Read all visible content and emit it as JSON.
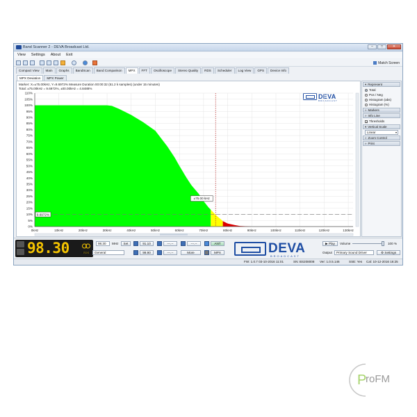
{
  "window": {
    "title": "Band Scanner 2 - DEVA Broadcast Ltd.",
    "controls": [
      "–",
      "□",
      "✕"
    ]
  },
  "menu": [
    "View",
    "Settings",
    "About",
    "Exit"
  ],
  "toolbar": {
    "match_screen": "Match Screen"
  },
  "tabs": [
    "Compact View",
    "Main",
    "Graphs",
    "BandScan",
    "Band Comparison",
    "MPX",
    "FFT",
    "Oscilloscope",
    "Stereo Quality",
    "RDS",
    "Scheduler",
    "Log View",
    "GPS",
    "Device Info"
  ],
  "active_tab": "MPX",
  "subtabs": [
    "MPX Deviation",
    "MPX Power"
  ],
  "active_subtab": "MPX Deviation",
  "info": {
    "line1": "Marker: X=±75.00kHz, Y=9.6972%    Measure Duration 00:00:32 (51.2 k samples) (under 15 minutes)",
    "line2": "Total: ±75.00kHz = 9.6972%, ±00.00kHz = 4.8488%"
  },
  "logo": {
    "name": "DEVA",
    "sub": "BROADCAST"
  },
  "chart_data": {
    "type": "area",
    "xlabel": "",
    "ylabel": "",
    "x_ticks": [
      "0kHz",
      "10kHz",
      "20kHz",
      "30kHz",
      "40kHz",
      "50kHz",
      "60kHz",
      "70kHz",
      "80kHz",
      "90kHz",
      "100kHz",
      "110kHz",
      "120kHz",
      "130kHz"
    ],
    "y_ticks": [
      "0%",
      "5%",
      "10%",
      "15%",
      "20%",
      "25%",
      "30%",
      "35%",
      "40%",
      "45%",
      "50%",
      "55%",
      "60%",
      "65%",
      "70%",
      "75%",
      "80%",
      "85%",
      "90%",
      "95%",
      "100%",
      "105%",
      "110%"
    ],
    "xlim": [
      0,
      132
    ],
    "ylim": [
      0,
      110
    ],
    "curve": {
      "x": [
        0,
        5,
        10,
        15,
        20,
        25,
        30,
        32,
        35,
        40,
        45,
        50,
        55,
        58,
        60,
        63,
        65,
        68,
        70,
        72,
        75,
        78,
        80,
        83,
        85,
        88,
        90
      ],
      "y": [
        100,
        100,
        100,
        100,
        100,
        100,
        100,
        99.5,
        97,
        92,
        86,
        79,
        66,
        57,
        50,
        40,
        34,
        27,
        21,
        16,
        9.7,
        4.5,
        2.5,
        1.2,
        0.5,
        0.2,
        0
      ]
    },
    "zones": [
      {
        "from": 0,
        "to": 73,
        "color": "#00ff00"
      },
      {
        "from": 73,
        "to": 78,
        "color": "#ffff00"
      },
      {
        "from": 78,
        "to": 132,
        "color": "#dd0000"
      }
    ],
    "marker_x": 75,
    "marker_y": 9.6972,
    "marker_label_x": "±75.00 kHz",
    "marker_label_y": "9.6972%",
    "threshold_y": 10,
    "colors": {
      "main_fill": "#00ff00",
      "overshoot": "#ffff00",
      "peak": "#dd0000",
      "marker": "#b22222"
    }
  },
  "right_panel": {
    "represent_label": "Represent",
    "represent_options": [
      "Total",
      "Pos / Neg",
      "Histogram (abs)",
      "Histogram (%)"
    ],
    "selected_option": "Total",
    "markers_label": "Markers",
    "infoline_label": "Info Line",
    "thresholds_label": "Thresholds",
    "thresholds_checked": true,
    "vertical_scale_label": "Vertical Scale",
    "scale_value": "Linear",
    "zoom_label": "Zoom Control",
    "print_label": "Print"
  },
  "bottom": {
    "frequency": "98.30",
    "badge": "RDS",
    "freq_field": "98.30",
    "freq_unit": "MHz",
    "set_label": "Set",
    "region_label": "Region",
    "region_value": "General",
    "presets_row1": [
      "91.10",
      "---.--",
      "---.--",
      "---.--"
    ],
    "presets_row2": [
      "99.90",
      "---.--",
      "More"
    ],
    "ant_label": "ANT",
    "mpx_label": "MPX",
    "play_label": "Play",
    "volume_label": "Volume",
    "volume_value": "100 %",
    "volume_level": 1.0,
    "output_label": "Output",
    "output_value": "Primary Sound Driver",
    "settings_label": "Settings"
  },
  "status": {
    "fw": "FW: 1.0.7 03-10-2016 11:01",
    "sn": "SN: BS208008",
    "ver": "Ver: 1.0.5.146",
    "sse": "SSE: Yes",
    "cal": "Cal: 10-12-2016 16:25"
  },
  "brand": {
    "text": "roFM",
    "first_letter": "P"
  }
}
